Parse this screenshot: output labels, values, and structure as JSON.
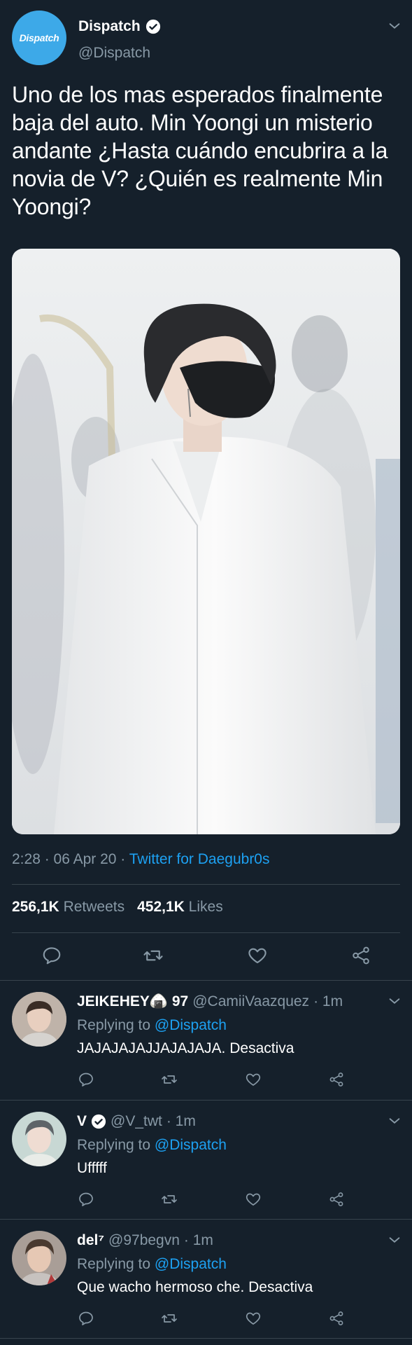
{
  "tweet": {
    "avatar_text": "Dispatch",
    "display_name": "Dispatch",
    "handle": "@Dispatch",
    "text": "Uno de los mas esperados finalmente baja del auto. Min Yoongi un misterio andante ¿Hasta cuándo encubrira a la novia de V? ¿Quién es realmente Min Yoongi?",
    "time": "2:28 · 06 Apr 20 · ",
    "source": "Twitter for Daegubr0s",
    "retweets_count": "256,1K",
    "retweets_label": "Retweets",
    "likes_count": "452,1K",
    "likes_label": "Likes"
  },
  "replies": [
    {
      "name": "JEIKEHEY🍙 97",
      "handle": "@CamiiVaazquez",
      "time": "· 1m",
      "replying_label": "Replying to",
      "replying_to": "@Dispatch",
      "text": "JAJAJAJAJJAJAJAJA. Desactiva",
      "verified": false
    },
    {
      "name": "V",
      "handle": "@V_twt",
      "time": "· 1m",
      "replying_label": "Replying to",
      "replying_to": "@Dispatch",
      "text": "Ufffff",
      "verified": true
    },
    {
      "name": "del⁷",
      "handle": "@97begvn",
      "time": "· 1m",
      "replying_label": "Replying to",
      "replying_to": "@Dispatch",
      "text": "Que wacho hermoso che. Desactiva",
      "verified": false
    }
  ],
  "icons": [
    "chevron-down-icon",
    "verified-icon",
    "reply-icon",
    "retweet-icon",
    "like-icon",
    "share-icon"
  ],
  "colors": {
    "background": "#15202b",
    "accent": "#1da1f2",
    "muted": "#8899a6",
    "divider": "#38444d"
  }
}
